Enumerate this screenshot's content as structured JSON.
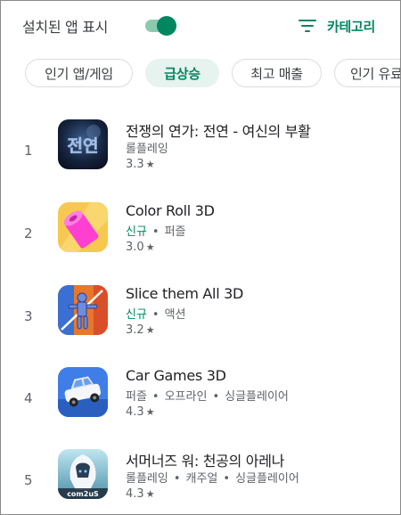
{
  "header": {
    "installed_label": "설치된 앱 표시",
    "toggle_on": true,
    "category_label": "카테고리"
  },
  "chips": [
    {
      "label": "인기 앱/게임",
      "active": false
    },
    {
      "label": "급상승",
      "active": true
    },
    {
      "label": "최고 매출",
      "active": false
    },
    {
      "label": "인기 유료",
      "active": false
    }
  ],
  "apps": [
    {
      "rank": "1",
      "title": "전쟁의 연가: 전연 - 여신의 부활",
      "new_badge": "",
      "tags": [
        "롤플레잉"
      ],
      "rating": "3.3",
      "icon": "jeonyeon-game-icon",
      "icon_text": "전연"
    },
    {
      "rank": "2",
      "title": "Color Roll 3D",
      "new_badge": "신규",
      "tags": [
        "퍼즐"
      ],
      "rating": "3.0",
      "icon": "color-roll-icon"
    },
    {
      "rank": "3",
      "title": "Slice them All 3D",
      "new_badge": "신규",
      "tags": [
        "액션"
      ],
      "rating": "3.2",
      "icon": "slice-them-all-icon"
    },
    {
      "rank": "4",
      "title": "Car Games 3D",
      "new_badge": "",
      "tags": [
        "퍼즐",
        "오프라인",
        "싱글플레이어"
      ],
      "rating": "4.3",
      "icon": "car-games-icon"
    },
    {
      "rank": "5",
      "title": "서머너즈 워: 천공의 아레나",
      "new_badge": "",
      "tags": [
        "롤플레잉",
        "캐주얼",
        "싱글플레이어"
      ],
      "rating": "4.3",
      "icon": "summoners-war-icon",
      "icon_text": "com2uS"
    }
  ],
  "star_glyph": "★",
  "separator": "•",
  "colors": {
    "accent": "#01875f",
    "chip_active_bg": "#e6f3ef"
  }
}
